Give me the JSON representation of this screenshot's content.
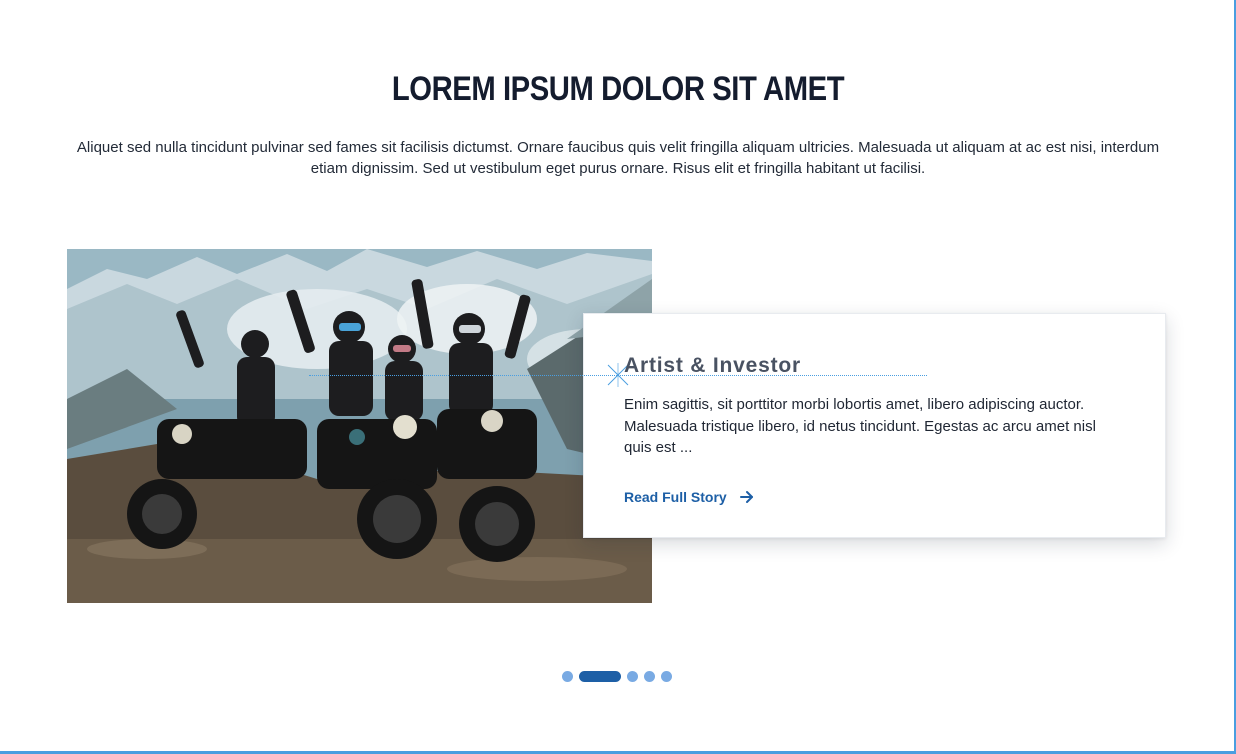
{
  "section": {
    "title": "LOREM IPSUM DOLOR SIT AMET",
    "intro": "Aliquet sed nulla tincidunt pulvinar sed fames sit facilisis dictumst. Ornare faucibus quis velit fringilla aliquam ultricies. Malesuada ut aliquam at ac est nisi, interdum etiam dignissim. Sed ut vestibulum eget purus ornare. Risus elit et fringilla habitant ut facilisi."
  },
  "story": {
    "role": "Artist & Investor",
    "body": "Enim sagittis, sit porttitor morbi lobortis amet, libero adipiscing auctor. Malesuada tristique libero, id netus tincidunt. Egestas ac arcu amet nisl quis est ...",
    "link_label": "Read Full Story",
    "link_icon": "arrow-right-icon"
  },
  "pagination": {
    "total": 5,
    "active_index": 1
  },
  "colors": {
    "accent": "#1d5fa6",
    "dot_inactive": "#79aae3",
    "frame": "#4a9ee0",
    "title": "#141c2e"
  }
}
